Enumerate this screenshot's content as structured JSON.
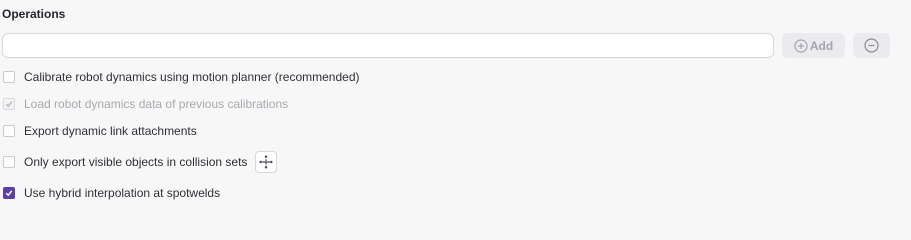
{
  "section": {
    "title": "Operations"
  },
  "operation_input": {
    "value": "",
    "placeholder": ""
  },
  "buttons": {
    "add_label": "Add",
    "add_icon": "plus-circle-icon",
    "remove_icon": "minus-circle-icon"
  },
  "options": [
    {
      "label": "Calibrate robot dynamics using motion planner (recommended)",
      "checked": false,
      "disabled": false
    },
    {
      "label": "Load robot dynamics data of previous calibrations",
      "checked": true,
      "disabled": true
    },
    {
      "label": "Export dynamic link attachments",
      "checked": false,
      "disabled": false
    },
    {
      "label": "Only export visible objects in collision sets",
      "checked": false,
      "disabled": false,
      "extra_icon": "move-arrows-icon"
    },
    {
      "label": "Use hybrid interpolation at spotwelds",
      "checked": true,
      "disabled": false
    }
  ],
  "colors": {
    "accent": "#5b3fa8",
    "background": "#f7f7f8",
    "disabled_text": "#a7a7b0"
  }
}
